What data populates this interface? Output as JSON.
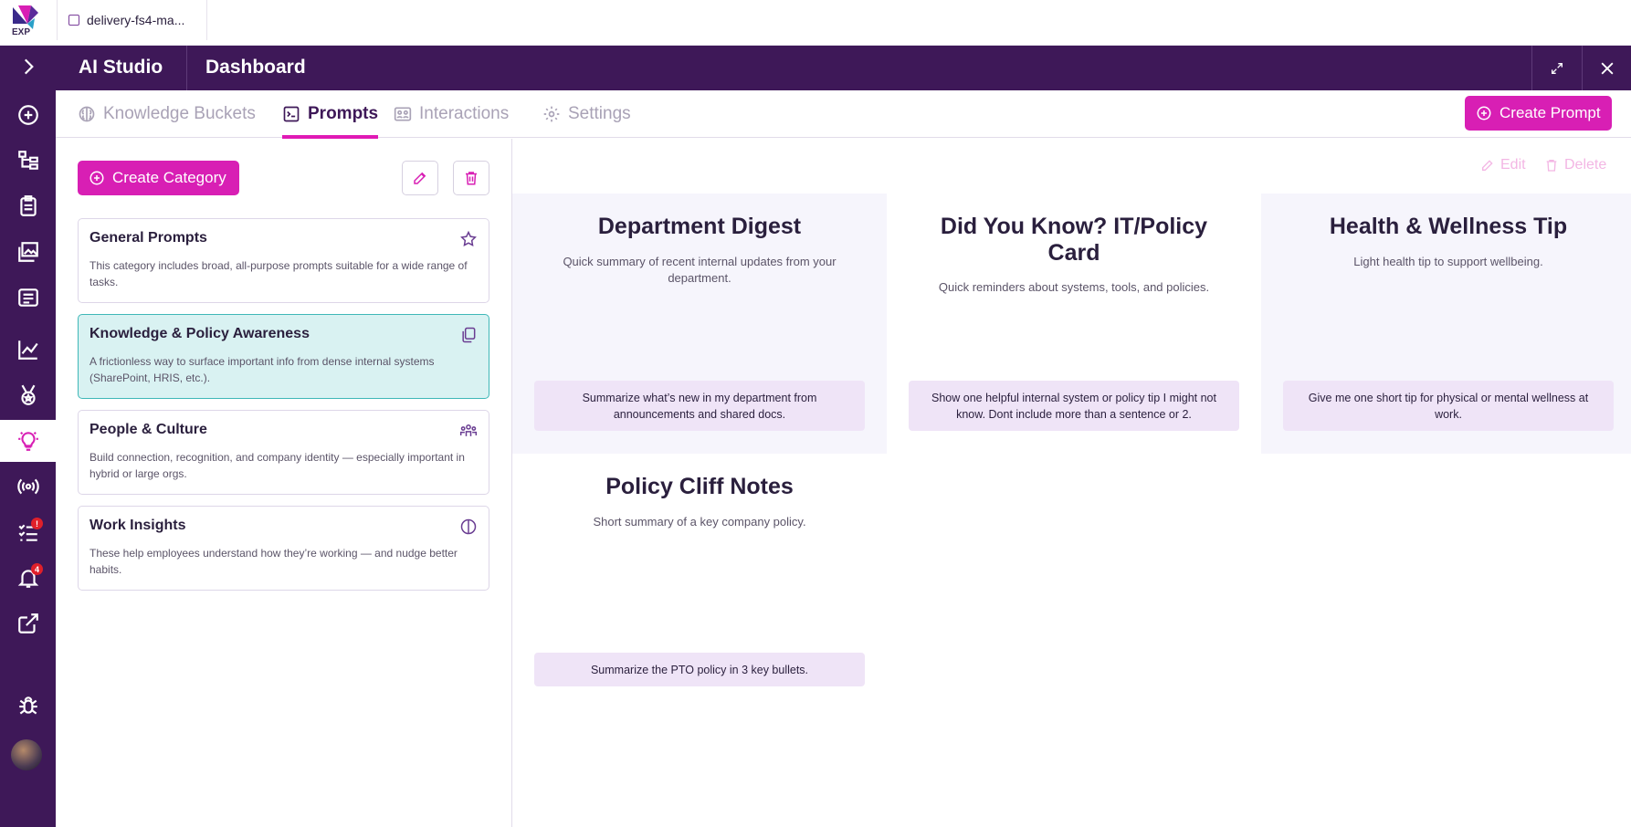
{
  "browser_tab": {
    "label": "delivery-fs4-ma..."
  },
  "logo": {
    "text": "EXP"
  },
  "header": {
    "app_title": "AI Studio",
    "page_title": "Dashboard"
  },
  "sidebar": {
    "items": [
      {
        "icon": "chevron-right-icon"
      },
      {
        "icon": "add-circle-icon"
      },
      {
        "icon": "hierarchy-icon"
      },
      {
        "icon": "clipboard-icon"
      },
      {
        "icon": "image-gallery-icon"
      },
      {
        "icon": "newspaper-icon"
      },
      {
        "icon": "line-chart-icon"
      },
      {
        "icon": "medal-icon"
      },
      {
        "icon": "lightbulb-icon",
        "active": true
      },
      {
        "icon": "broadcast-icon"
      },
      {
        "icon": "task-list-icon",
        "badge": "!"
      },
      {
        "icon": "bell-icon",
        "badge": "4"
      },
      {
        "icon": "external-link-icon"
      },
      {
        "icon": "bug-icon"
      },
      {
        "icon": "lightbulb-outline-icon"
      }
    ]
  },
  "tabs": [
    {
      "label": "Knowledge Buckets",
      "icon": "brain-icon"
    },
    {
      "label": "Prompts",
      "icon": "terminal-icon",
      "active": true
    },
    {
      "label": "Interactions",
      "icon": "people-icon"
    },
    {
      "label": "Settings",
      "icon": "gear-icon"
    }
  ],
  "create_prompt_label": "Create Prompt",
  "create_category_label": "Create Category",
  "categories": [
    {
      "title": "General Prompts",
      "description": "This category includes broad, all-purpose prompts suitable for a wide range of tasks.",
      "icon": "star-icon"
    },
    {
      "title": "Knowledge & Policy Awareness",
      "description": "A frictionless way to surface important info from dense internal systems (SharePoint, HRIS, etc.).",
      "icon": "copy-icon",
      "selected": true
    },
    {
      "title": "People & Culture",
      "description": "Build connection, recognition, and company identity — especially important in hybrid or large orgs.",
      "icon": "group-icon"
    },
    {
      "title": "Work Insights",
      "description": "These help employees understand how they’re working — and nudge better habits.",
      "icon": "half-circle-icon"
    }
  ],
  "actions": {
    "edit_label": "Edit",
    "delete_label": "Delete"
  },
  "prompts": [
    {
      "title": "Department Digest",
      "description": "Quick summary of recent internal updates from your department.",
      "prompt": "Summarize what’s new in my department from announcements and shared docs."
    },
    {
      "title": "Did You Know? IT/Policy Card",
      "description": "Quick reminders about systems, tools, and policies.",
      "prompt": "Show one helpful internal system or policy tip I might not know. Dont include more than a sentence or 2."
    },
    {
      "title": "Health & Wellness Tip",
      "description": "Light health tip to support wellbeing.",
      "prompt": "Give me one short tip for physical or mental wellness at work."
    },
    {
      "title": "Policy Cliff Notes",
      "description": "Short summary of a key company policy.",
      "prompt": "Summarize the PTO policy in 3 key bullets."
    }
  ],
  "colors": {
    "brand_dark": "#3e1858",
    "accent": "#d81fb4",
    "selected_bg": "#d9f2f2"
  }
}
